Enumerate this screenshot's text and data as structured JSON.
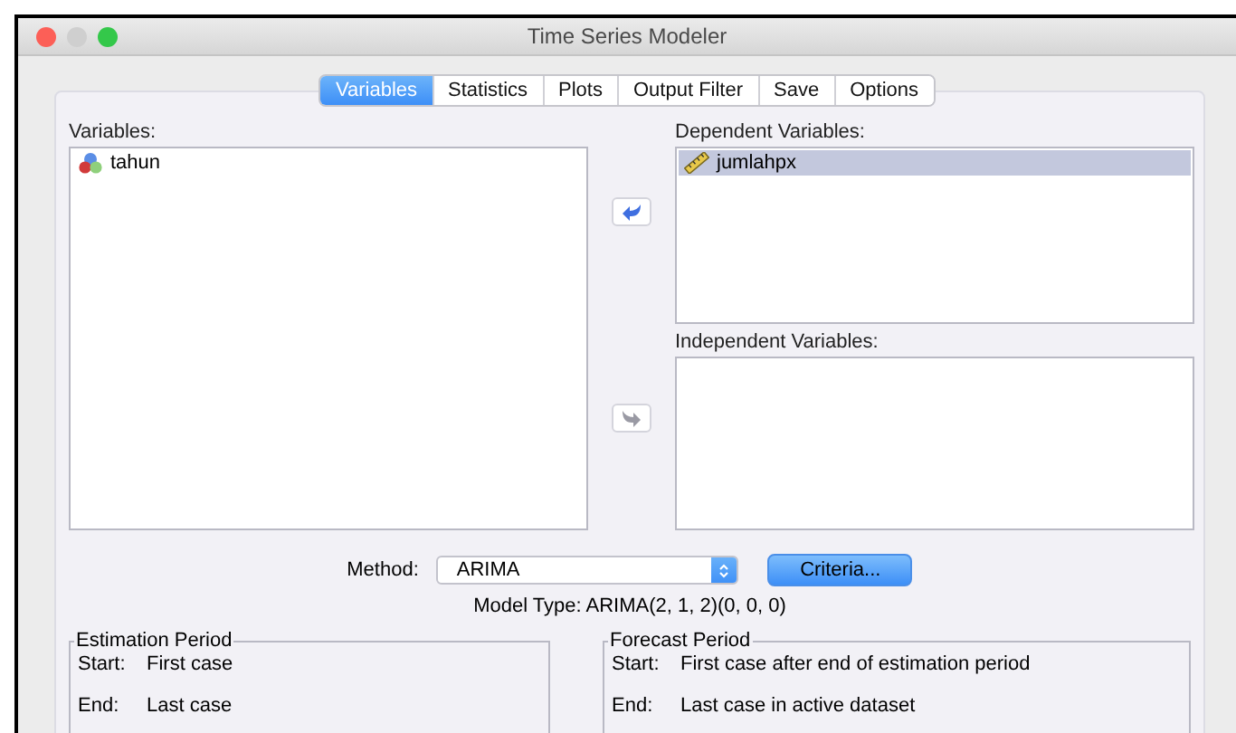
{
  "window": {
    "title": "Time Series Modeler"
  },
  "tabs": [
    {
      "label": "Variables",
      "selected": true
    },
    {
      "label": "Statistics",
      "selected": false
    },
    {
      "label": "Plots",
      "selected": false
    },
    {
      "label": "Output Filter",
      "selected": false
    },
    {
      "label": "Save",
      "selected": false
    },
    {
      "label": "Options",
      "selected": false
    }
  ],
  "variables": {
    "label": "Variables:",
    "items": [
      {
        "name": "tahun",
        "kind": "nominal",
        "selected": false
      }
    ]
  },
  "move_buttons": [
    {
      "disabled": false
    },
    {
      "disabled": true
    }
  ],
  "dependent": {
    "label": "Dependent Variables:",
    "items": [
      {
        "name": "jumlahpx",
        "kind": "scale",
        "selected": true
      }
    ]
  },
  "independent": {
    "label": "Independent Variables:"
  },
  "method": {
    "label": "Method:",
    "value": "ARIMA",
    "criteria_button": "Criteria..."
  },
  "model_type": "Model Type: ARIMA(2, 1, 2)(0, 0, 0)",
  "estimation_period": {
    "title": "Estimation Period",
    "rows": [
      {
        "key": "Start:",
        "value": "First case"
      },
      {
        "key": "End:",
        "value": "Last case"
      }
    ]
  },
  "forecast_period": {
    "title": "Forecast Period",
    "rows": [
      {
        "key": "Start:",
        "value": "First case after end of estimation period"
      },
      {
        "key": "End:",
        "value": "Last case in active dataset"
      }
    ]
  }
}
